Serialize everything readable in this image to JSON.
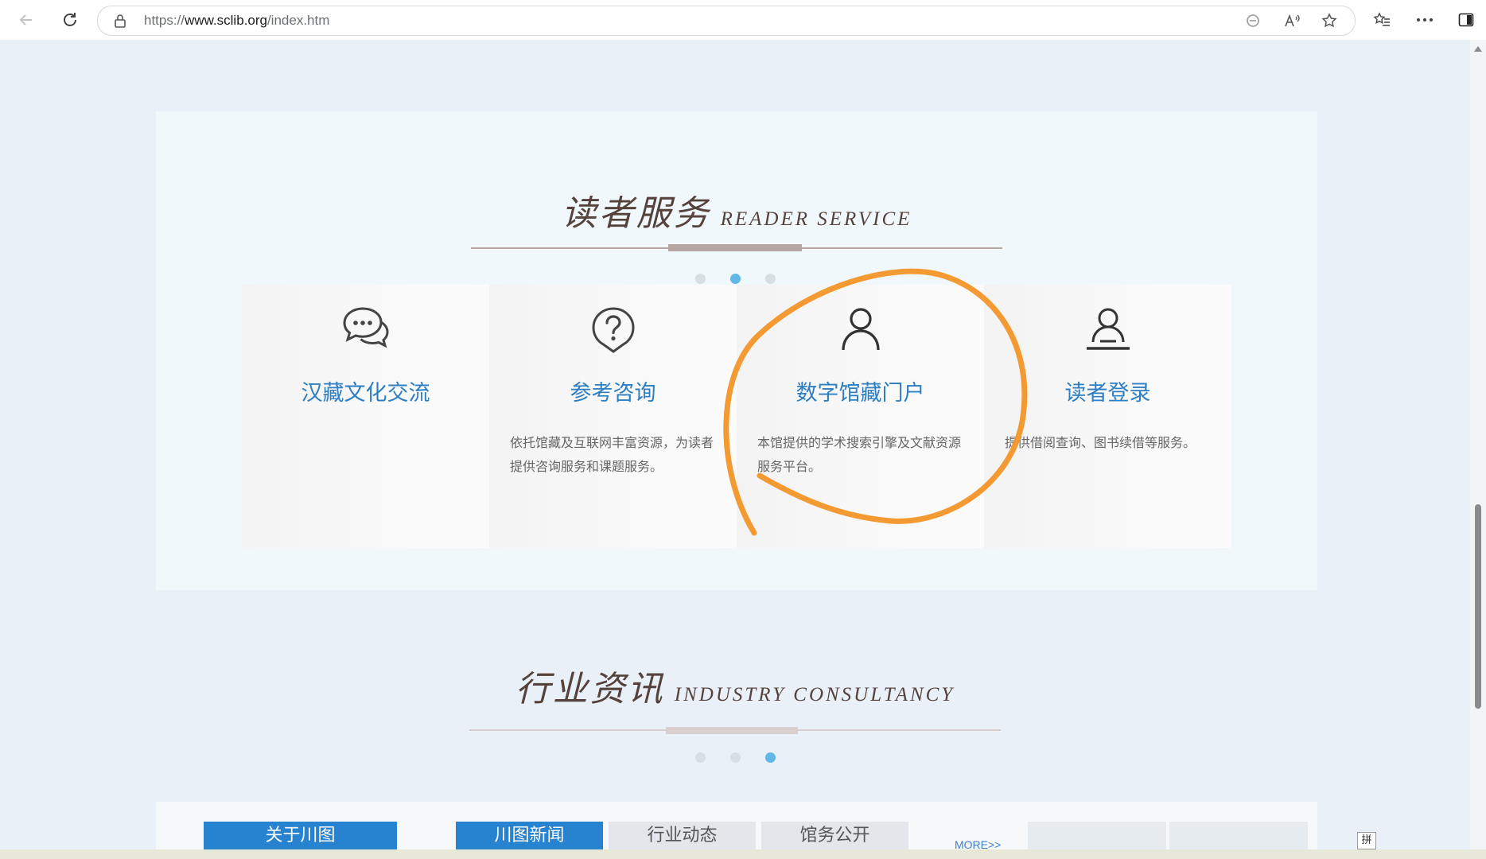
{
  "browser": {
    "url_prefix": "https://",
    "url_host": "www.sclib.org",
    "url_path": "/index.htm"
  },
  "reader_service": {
    "title_cn": "读者服务",
    "title_en": "READER SERVICE",
    "pager": {
      "total": 3,
      "active_index": 1
    },
    "cards": [
      {
        "title": "汉藏文化交流",
        "description": "",
        "icon": "chat-bubbles-icon"
      },
      {
        "title": "参考咨询",
        "description": "依托馆藏及互联网丰富资源，为读者提供咨询服务和课题服务。",
        "icon": "question-circle-icon"
      },
      {
        "title": "数字馆藏门户",
        "description": "本馆提供的学术搜索引擎及文献资源服务平台。",
        "icon": "user-icon"
      },
      {
        "title": "读者登录",
        "description": "提供借阅查询、图书续借等服务。",
        "icon": "user-login-icon"
      }
    ]
  },
  "industry": {
    "title_cn": "行业资讯",
    "title_en": "INDUSTRY CONSULTANCY",
    "pager": {
      "total": 3,
      "active_index": 2
    }
  },
  "bottom_tabs": {
    "about": "关于川图",
    "news": "川图新闻",
    "industry_news": "行业动态",
    "affairs": "馆务公开",
    "more": "MORE>>"
  },
  "ime_indicator": "拼",
  "colors": {
    "accent_blue": "#2783cf",
    "card_title": "#2e7ec2",
    "annotation_orange": "#f39a33",
    "active_dot": "#5fb8e6"
  }
}
